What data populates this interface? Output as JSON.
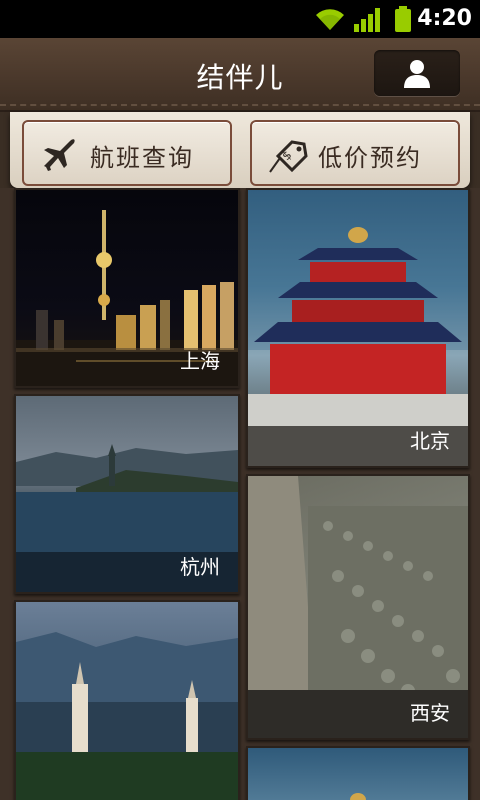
{
  "status_bar": {
    "time": "4:20"
  },
  "header": {
    "title": "结伴儿"
  },
  "actions": [
    {
      "label": "航班查询",
      "icon": "plane-icon"
    },
    {
      "label": "低价预约",
      "icon": "price-tag-icon"
    }
  ],
  "cities": [
    {
      "name": "上海"
    },
    {
      "name": "北京"
    },
    {
      "name": "杭州"
    },
    {
      "name": "西安"
    },
    {
      "name": ""
    },
    {
      "name": ""
    }
  ],
  "colors": {
    "header_bg": "#4a382b",
    "panel_bg": "#efe8dc",
    "button_border": "#7a4c3a",
    "battery_green": "#8bc34a"
  }
}
